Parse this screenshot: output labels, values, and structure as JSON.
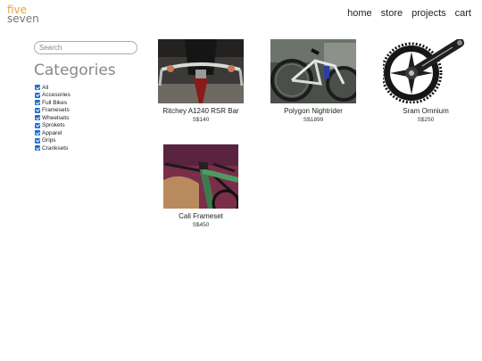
{
  "logo": {
    "line1": "five",
    "line2": "seven"
  },
  "nav": {
    "items": [
      {
        "label": "home"
      },
      {
        "label": "store"
      },
      {
        "label": "projects"
      },
      {
        "label": "cart"
      }
    ]
  },
  "search": {
    "placeholder": "Search",
    "value": ""
  },
  "categories": {
    "title": "Categories",
    "items": [
      {
        "label": "All",
        "checked": true
      },
      {
        "label": "Accesories",
        "checked": true
      },
      {
        "label": "Full Bikes",
        "checked": true
      },
      {
        "label": "Framesets",
        "checked": true
      },
      {
        "label": "Wheelsets",
        "checked": true
      },
      {
        "label": "Sprokets",
        "checked": true
      },
      {
        "label": "Apparel",
        "checked": true
      },
      {
        "label": "Grips",
        "checked": true
      },
      {
        "label": "Cranksets",
        "checked": true
      }
    ]
  },
  "products": [
    {
      "name": "Ritchey A1240 RSR Bar",
      "price": "S$140",
      "image": "handlebar-photo"
    },
    {
      "name": "Polygon Nightrider",
      "price": "S$1899",
      "image": "bike-photo"
    },
    {
      "name": "Sram Omnium",
      "price": "S$250",
      "image": "crankset-photo"
    },
    {
      "name": "Cali Frameset",
      "price": "S$450",
      "image": "frameset-photo"
    }
  ],
  "colors": {
    "logo_accent": "#e8a23a",
    "logo_secondary": "#777777",
    "checkbox": "#1f6fd1"
  }
}
